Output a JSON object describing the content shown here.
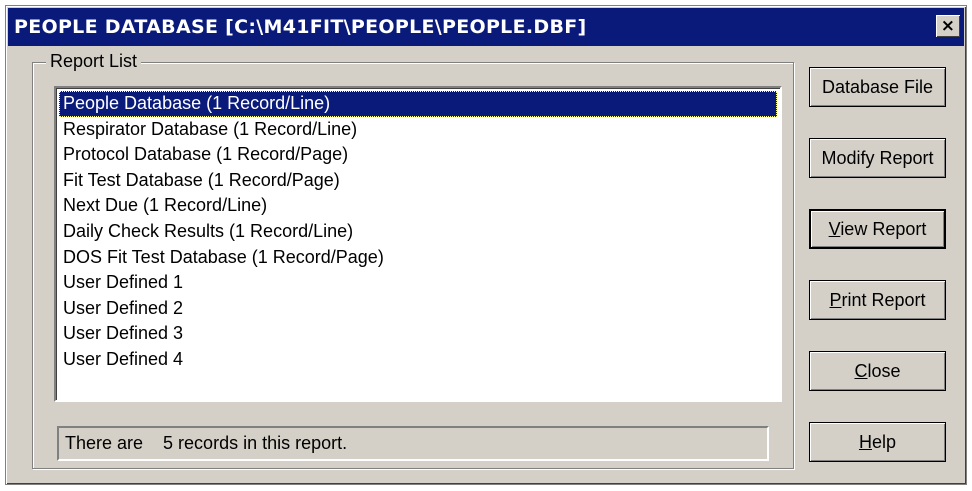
{
  "window": {
    "title": "PEOPLE DATABASE [C:\\M41FIT\\PEOPLE\\PEOPLE.DBF]",
    "close_glyph": "×"
  },
  "report_list": {
    "label": "Report List",
    "items": [
      "People Database (1 Record/Line)",
      "Respirator Database (1 Record/Line)",
      "Protocol Database (1 Record/Page)",
      "Fit Test Database (1 Record/Page)",
      "Next Due (1 Record/Line)",
      "Daily Check Results (1 Record/Line)",
      "DOS Fit Test Database (1 Record/Page)",
      "User Defined 1",
      "User Defined 2",
      "User Defined 3",
      "User Defined 4"
    ],
    "selected_index": 0
  },
  "status": {
    "text": "There are    5 records in this report."
  },
  "buttons": {
    "database_file": "Database File",
    "modify_report": "Modify Report",
    "view_report": {
      "mnemonic": "V",
      "rest": "iew Report"
    },
    "print_report": {
      "mnemonic": "P",
      "rest": "rint Report"
    },
    "close": {
      "mnemonic": "C",
      "rest": "lose"
    },
    "help": {
      "mnemonic": "H",
      "rest": "elp"
    }
  },
  "colors": {
    "title_bar": "#0a1a7a",
    "selection": "#0a1a7a",
    "face": "#d4d0c8"
  }
}
